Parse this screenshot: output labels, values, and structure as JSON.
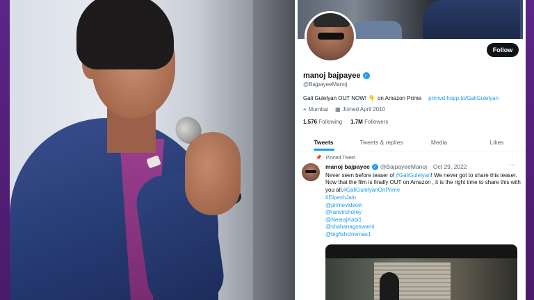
{
  "profile": {
    "display_name": "manoj bajpayee",
    "handle": "@BajpayeeManoj",
    "follow_label": "Follow",
    "verified_icon": "verified-badge-icon",
    "bio_text": "Gali Gulelyan OUT NOW!",
    "bio_emoji": "👇",
    "bio_suffix": "on Amazon Prime",
    "bio_link": "primvd.hopp.to/GaliGulelyan",
    "location": "Mumbai",
    "joined": "Joined April 2010",
    "following_count": "1,576",
    "following_label": "Following",
    "followers_count": "1.7M",
    "followers_label": "Followers"
  },
  "tabs": [
    {
      "label": "Tweets",
      "active": true
    },
    {
      "label": "Tweets & replies",
      "active": false
    },
    {
      "label": "Media",
      "active": false
    },
    {
      "label": "Likes",
      "active": false
    }
  ],
  "tweet": {
    "pinned_label": "Pinned Tweet",
    "author_name": "manoj bajpayee",
    "author_handle": "@BajpayeeManoj",
    "separator": "·",
    "date": "Oct 29, 2022",
    "more_icon": "···",
    "body_1": "Never seen before teaser of ",
    "body_tag_1": "#GaliGulelyan",
    "body_2": "! We never got to share this teaser. Now that the film is finally OUT on Amazon , it is the right time to share this with you all.",
    "body_tag_2": "#GaliGulelyanOnPrime",
    "mentions": [
      "#DipeshJain",
      "@primevideoin",
      "@ranvirshorey",
      "@NeerajKabi1",
      "@shahanagoswami",
      "@bigfishcinemas1"
    ]
  },
  "colors": {
    "accent": "#1d9bf0",
    "frame": "#4a1a6b",
    "text_primary": "#0f1419",
    "text_secondary": "#536471"
  }
}
